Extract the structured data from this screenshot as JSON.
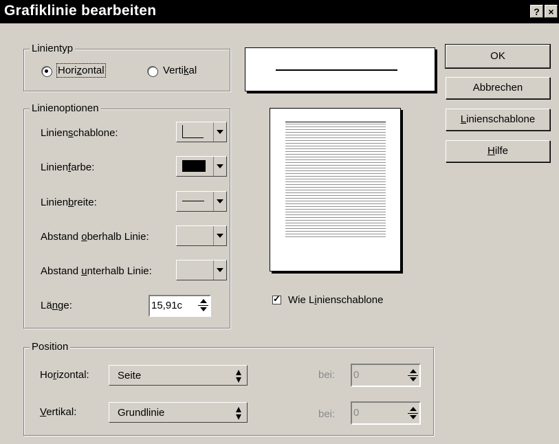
{
  "window": {
    "title": "Grafiklinie bearbeiten",
    "help_glyph": "?",
    "close_glyph": "×"
  },
  "linientyp": {
    "legend": "Linientyp",
    "horizontal": {
      "pre": "Hori",
      "u": "z",
      "post": "ontal",
      "selected": true
    },
    "vertikal": {
      "pre": "Verti",
      "u": "k",
      "post": "al",
      "selected": false
    }
  },
  "linienoptionen": {
    "legend": "Linienoptionen",
    "schablone": {
      "pre": "Linien",
      "u": "s",
      "post": "chablone:"
    },
    "farbe": {
      "pre": "Linien",
      "u": "f",
      "post": "arbe:"
    },
    "breite": {
      "pre": "Linien",
      "u": "b",
      "post": "reite:"
    },
    "oberhalb": {
      "pre": "Abstand ",
      "u": "o",
      "post": "berhalb Linie:"
    },
    "unterhalb": {
      "pre": "Abstand ",
      "u": "u",
      "post": "nterhalb Linie:"
    },
    "laenge": {
      "pre": "Lä",
      "u": "n",
      "post": "ge:",
      "value": "15,91c"
    }
  },
  "preview": {
    "checkbox": {
      "pre": "Wie L",
      "u": "i",
      "post": "nienschablone",
      "checked": true
    }
  },
  "buttons": {
    "ok": "OK",
    "abbrechen": "Abbrechen",
    "linienschablone": {
      "pre": "",
      "u": "L",
      "post": "inienschablone"
    },
    "hilfe": {
      "pre": "",
      "u": "H",
      "post": "ilfe"
    }
  },
  "position": {
    "legend": "Position",
    "horizontal": {
      "pre": "Ho",
      "u": "r",
      "post": "izontal:",
      "select": "Seite",
      "bei_label": "bei:",
      "bei_value": "0"
    },
    "vertikal": {
      "pre": "",
      "u": "V",
      "post": "ertikal:",
      "select": "Grundlinie",
      "bei_label": "bei:",
      "bei_value": "0"
    }
  }
}
